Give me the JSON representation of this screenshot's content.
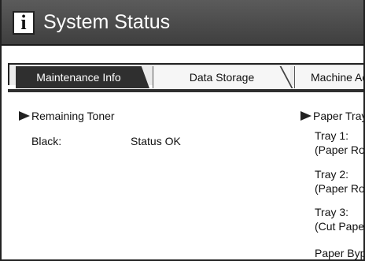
{
  "header": {
    "icon": "info-icon",
    "icon_glyph": "i",
    "title": "System Status"
  },
  "tabs": [
    {
      "label": "Maintenance Info",
      "active": true
    },
    {
      "label": "Data Storage",
      "active": false
    },
    {
      "label": "Machine Ad",
      "active": false
    }
  ],
  "left": {
    "section_title": "Remaining Toner",
    "rows": [
      {
        "label": "Black:",
        "value": "Status OK"
      }
    ]
  },
  "right": {
    "section_title": "Paper Tray",
    "trays": [
      {
        "name": "Tray 1:",
        "detail": "(Paper Rol"
      },
      {
        "name": "Tray 2:",
        "detail": "(Paper Rol"
      },
      {
        "name": "Tray 3:",
        "detail": "(Cut Paper"
      },
      {
        "name": "Paper Bypa",
        "detail": ""
      }
    ]
  },
  "colors": {
    "title_bar": "#4a4a4a",
    "active_tab": "#2f2f2f",
    "inactive_tab": "#f6f6f6"
  }
}
